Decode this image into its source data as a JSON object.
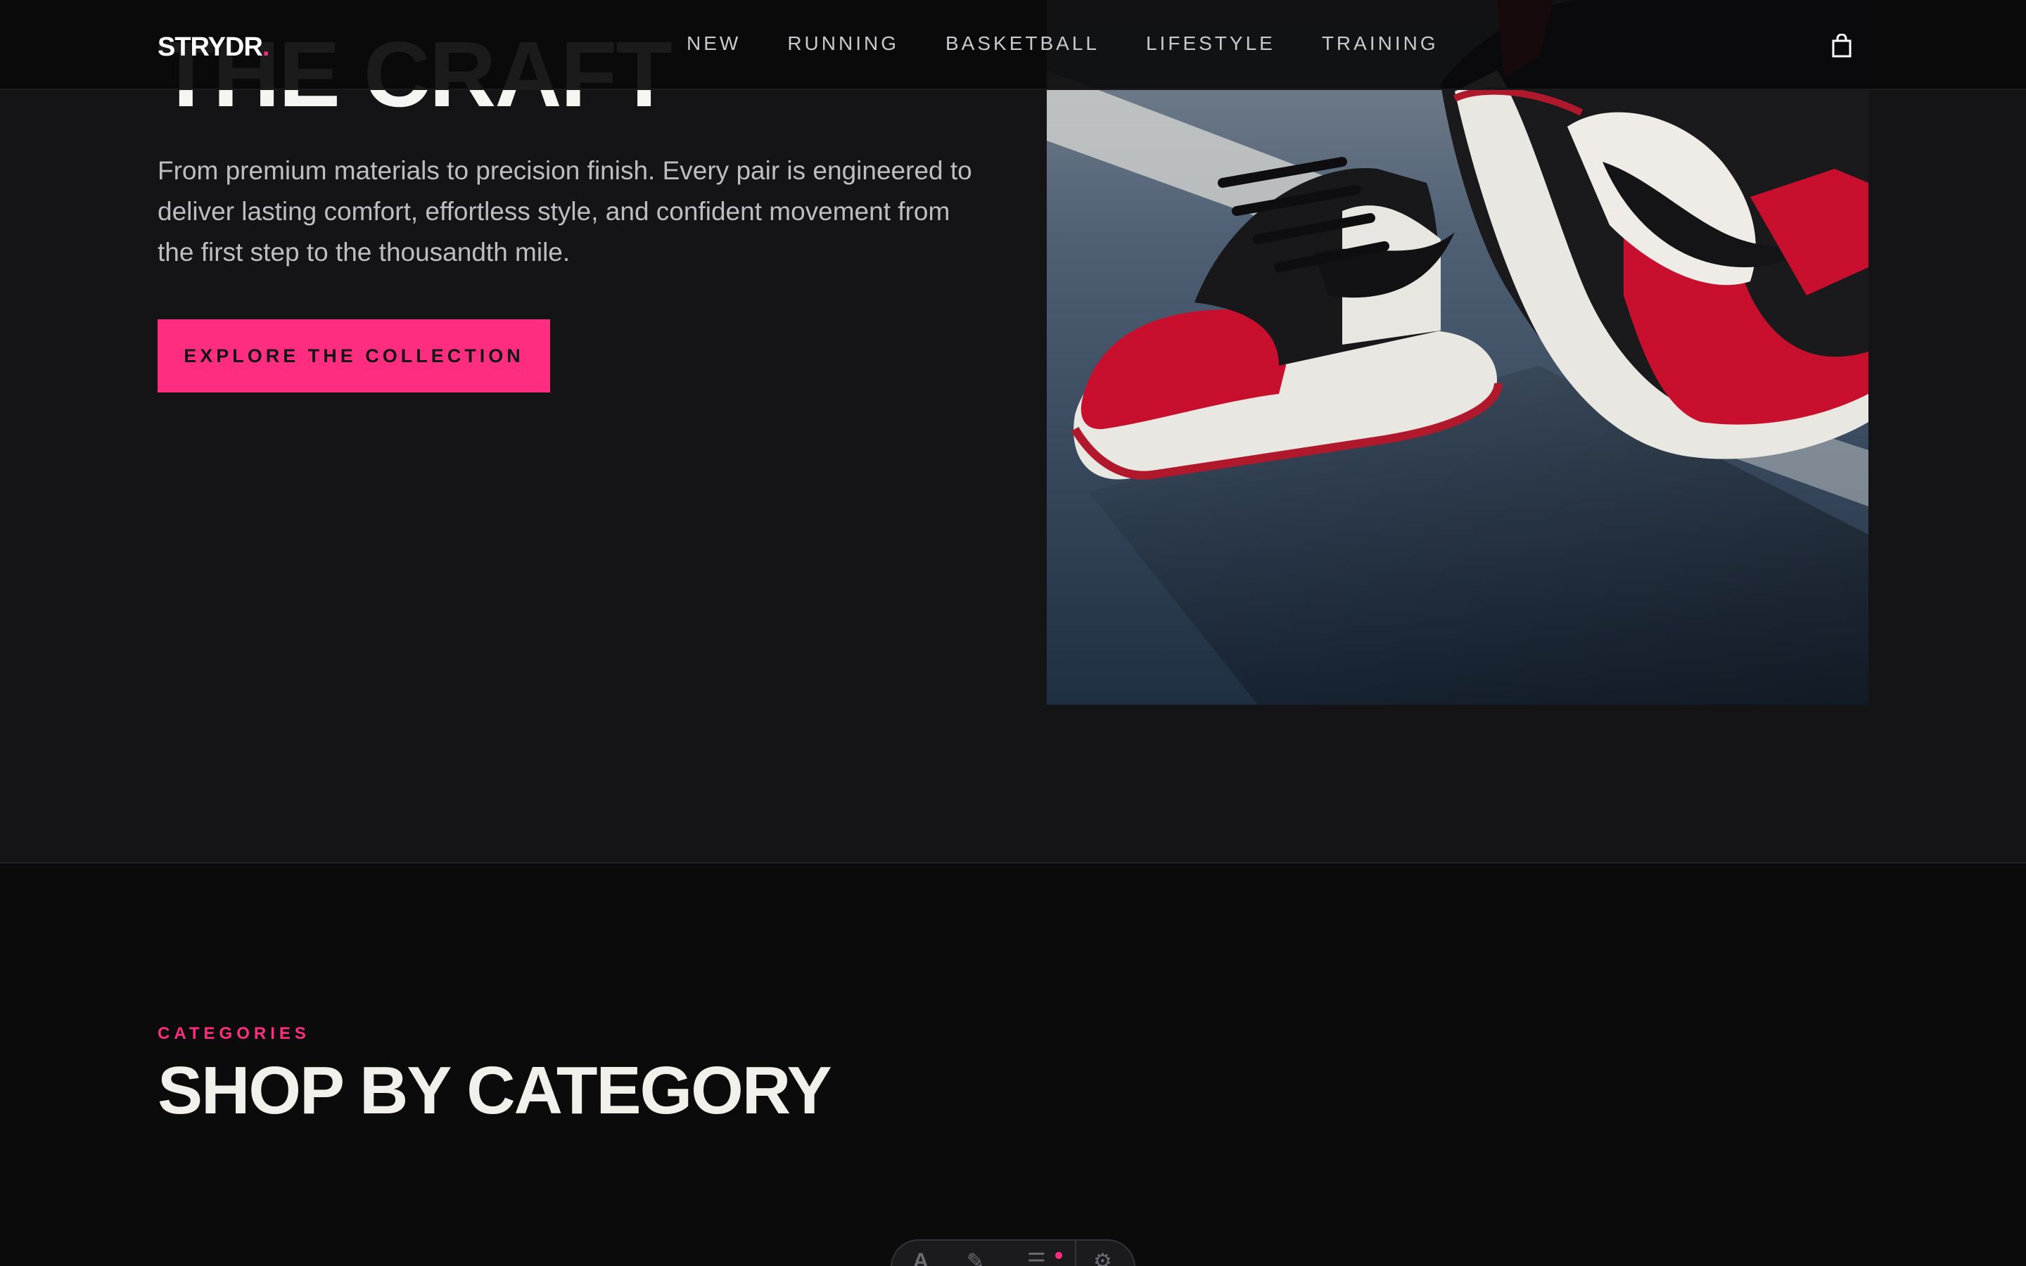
{
  "brand": {
    "name": "STRYDR",
    "dot": ".",
    "accent_color": "#ff2d7f"
  },
  "nav": {
    "links": [
      "NEW",
      "RUNNING",
      "BASKETBALL",
      "LIFESTYLE",
      "TRAINING"
    ],
    "cart_icon": "shopping-bag-icon"
  },
  "hero": {
    "heading": "THE CRAFT",
    "description": "From premium materials to precision finish. Every pair is engineered to deliver lasting comfort, effortless style, and confident movement from the first step to the thousandth mile.",
    "cta_label": "EXPLORE THE COLLECTION",
    "image_icon": "sneaker-photo"
  },
  "categories": {
    "eyebrow": "CATEGORIES",
    "title": "SHOP BY CATEGORY"
  },
  "toolbar": {
    "icons": [
      "text-icon",
      "pen-icon",
      "menu-icon",
      "gear-icon"
    ]
  }
}
